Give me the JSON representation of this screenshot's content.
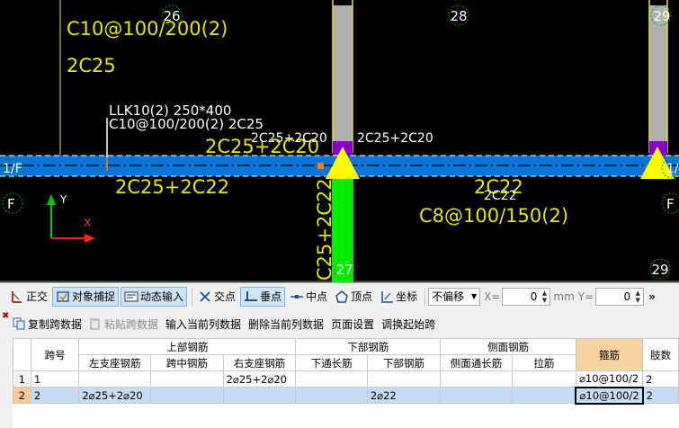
{
  "canvas": {
    "grid_numbers": [
      "26",
      "28",
      "29",
      "27",
      "29"
    ],
    "axis_labels": [
      "1/F",
      "1/",
      "F",
      "F"
    ],
    "big_annotation_line1": "C10@100/200(2)",
    "big_annotation_line2": "2C25",
    "beam_title_line1": "LLK10(2) 250*400",
    "beam_title_line2": "C10@100/200(2) 2C25",
    "small_top_left": "2C25+2C20",
    "small_top_right": "2C25+2C20",
    "big_top_left": "2C25+2C20",
    "bottom_left": "2C25+2C22",
    "bottom_right": "2C22",
    "bottom_right_small": "2C22",
    "stirrup_right": "C8@100/150(2)",
    "column_vertical_text": "C25+2C22",
    "ucs_y": "Y",
    "ucs_x": "X",
    "colors": {
      "beam": "#0a74d8",
      "column": "#b0b0b0",
      "text": "#e6e600",
      "triangle": "#ffff00",
      "purple": "#8a00c8",
      "green": "#00ee00"
    }
  },
  "snap_toolbar": {
    "ortho": "正交",
    "object_snap": "对象捕捉",
    "dynamic_input": "动态输入",
    "intersection": "交点",
    "perpendicular": "垂点",
    "midpoint": "中点",
    "vertex": "顶点",
    "coordinate": "坐标",
    "offset_mode": "不偏移",
    "x_label": "X=",
    "x_value": "0",
    "unit": "mm",
    "y_label": "Y=",
    "y_value": "0",
    "more": "»"
  },
  "panel": {
    "close": "✖",
    "toolbar": {
      "copy_span": "复制跨数据",
      "paste_span": "粘贴跨数据",
      "input_column": "输入当前列数据",
      "delete_column": "删除当前列数据",
      "page_setup": "页面设置",
      "adjust_start": "调换起始跨"
    },
    "table": {
      "headers": {
        "span_no": "跨号",
        "top_rebar": "上部钢筋",
        "bottom_rebar": "下部钢筋",
        "side_rebar": "侧面钢筋",
        "stirrup": "箍筋",
        "legs": "肢数",
        "left_support": "左支座钢筋",
        "mid_span": "跨中钢筋",
        "right_support": "右支座钢筋",
        "bottom_through": "下通长筋",
        "bottom_bars": "下部钢筋",
        "side_through": "侧面通长筋",
        "tie": "拉筋"
      },
      "rows": [
        {
          "row": "1",
          "span": "1",
          "left": "",
          "mid": "",
          "right": "2⌀25+2⌀20",
          "bot_through": "",
          "bot": "",
          "side": "",
          "tie": "",
          "stirrup": "⌀10@100/2",
          "legs": "2"
        },
        {
          "row": "2",
          "span": "2",
          "left": "2⌀25+2⌀20",
          "mid": "",
          "right": "",
          "bot_through": "",
          "bot": "2⌀22",
          "side": "",
          "tie": "",
          "stirrup": "⌀10@100/2",
          "legs": "2"
        }
      ]
    }
  }
}
